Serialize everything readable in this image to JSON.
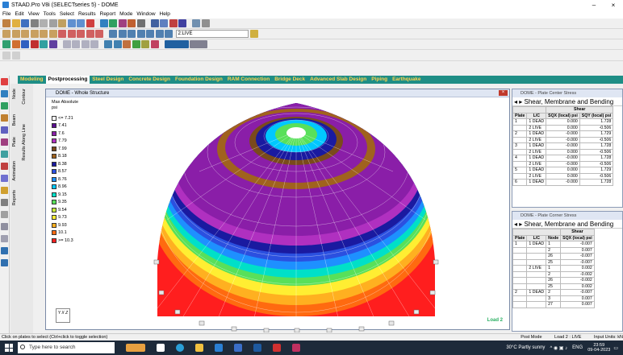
{
  "window": {
    "title": "STAAD.Pro V8i (SELECTseries 5) - DOME",
    "minimize": "–",
    "close": "×"
  },
  "menu": [
    "File",
    "Edit",
    "View",
    "Tools",
    "Select",
    "Results",
    "Report",
    "Mode",
    "Window",
    "Help"
  ],
  "toolbar": {
    "load_case_value": "2:LIVE"
  },
  "mode_tabs": [
    "Modeling",
    "Postprocessing",
    "Steel Design",
    "Concrete Design",
    "Foundation Design",
    "RAM Connection",
    "Bridge Deck",
    "Advanced Slab Design",
    "Piping",
    "Earthquake"
  ],
  "active_tab": "Postprocessing",
  "vertical_tabs": [
    "Node",
    "Beam",
    "Plate",
    "Animation",
    "Reports",
    "Contour",
    "Results Along Line"
  ],
  "main_window": {
    "title": "DOME - Whole Structure",
    "legend_heading": [
      "Max Absolute",
      "psi"
    ],
    "legend": [
      {
        "label": "<= 7.21",
        "color": "#ffffff"
      },
      {
        "label": "7.41",
        "color": "#5b0e91"
      },
      {
        "label": "7.6",
        "color": "#8a1ea8"
      },
      {
        "label": "7.79",
        "color": "#b030c0"
      },
      {
        "label": "7.99",
        "color": "#7a4a1c"
      },
      {
        "label": "8.18",
        "color": "#a0621e"
      },
      {
        "label": "8.38",
        "color": "#1a1aa0"
      },
      {
        "label": "8.57",
        "color": "#2b50e0"
      },
      {
        "label": "8.76",
        "color": "#1e90ff"
      },
      {
        "label": "8.96",
        "color": "#00c8ff"
      },
      {
        "label": "9.15",
        "color": "#00e0c8"
      },
      {
        "label": "9.35",
        "color": "#58e05a"
      },
      {
        "label": "9.54",
        "color": "#c8e83a"
      },
      {
        "label": "9.73",
        "color": "#ffee32"
      },
      {
        "label": "9.93",
        "color": "#ffb020"
      },
      {
        "label": "10.1",
        "color": "#ff6a10"
      },
      {
        "label": ">= 10.3",
        "color": "#ff1e1e"
      }
    ],
    "axis_indicator": "Y X Z",
    "load_label": "Load 2"
  },
  "side_top": {
    "title": "DOME - Plate Center Stress",
    "nav": "Shear, Membrane and Bending",
    "group_header": "Shear",
    "headers": [
      "Plate",
      "L/C",
      "SQX (local) psi",
      "SQY (local) psi"
    ],
    "rows": [
      [
        "1",
        "1 DEAD",
        "0.000",
        "1.728"
      ],
      [
        "",
        "2 LIVE",
        "0.000",
        "-0.506"
      ],
      [
        "2",
        "1 DEAD",
        "-0.000",
        "1.729"
      ],
      [
        "",
        "2 LIVE",
        "-0.000",
        "-0.506"
      ],
      [
        "3",
        "1 DEAD",
        "-0.000",
        "1.728"
      ],
      [
        "",
        "2 LIVE",
        "0.000",
        "-0.506"
      ],
      [
        "4",
        "1 DEAD",
        "-0.000",
        "1.728"
      ],
      [
        "",
        "2 LIVE",
        "-0.000",
        "-0.506"
      ],
      [
        "5",
        "1 DEAD",
        "0.000",
        "1.729"
      ],
      [
        "",
        "2 LIVE",
        "0.000",
        "-0.506"
      ],
      [
        "6",
        "1 DEAD",
        "-0.000",
        "1.728"
      ]
    ]
  },
  "side_bottom": {
    "title": "DOME - Plate Corner Stress",
    "nav": "Shear, Membrane and Bending",
    "group_header": "Shear",
    "headers": [
      "Plate",
      "L/C",
      "Node",
      "SQX (local) psi"
    ],
    "rows": [
      [
        "1",
        "1 DEAD",
        "1",
        "-0.007"
      ],
      [
        "",
        "",
        "2",
        "0.007"
      ],
      [
        "",
        "",
        "26",
        "-0.007"
      ],
      [
        "",
        "",
        "25",
        "-0.007"
      ],
      [
        "",
        "2 LIVE",
        "1",
        "0.002"
      ],
      [
        "",
        "",
        "2",
        "-0.002"
      ],
      [
        "",
        "",
        "26",
        "-0.002"
      ],
      [
        "",
        "",
        "25",
        "0.002"
      ],
      [
        "2",
        "1 DEAD",
        "2",
        "-0.007"
      ],
      [
        "",
        "",
        "3",
        "0.007"
      ],
      [
        "",
        "",
        "27",
        "0.007"
      ]
    ]
  },
  "status": {
    "hint": "Click on plates to select (Ctrl+click to toggle selection)",
    "mode": "Post Mode",
    "load": "Load 2 : LIVE",
    "units": "Input Units: kN"
  },
  "taskbar": {
    "search_placeholder": "Type here to search",
    "weather": "30°C Partly sunny",
    "lang": "ENG",
    "time": "23:59",
    "date": "09-04-2023"
  }
}
